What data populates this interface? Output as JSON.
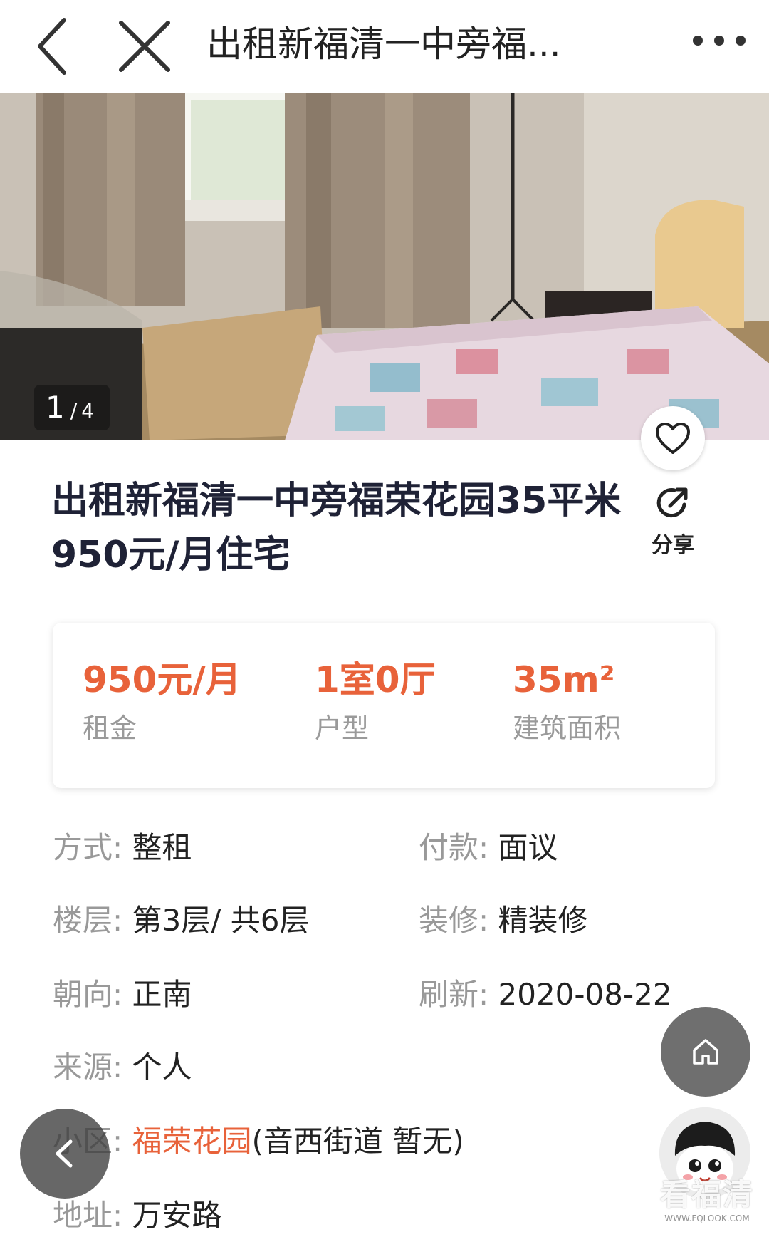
{
  "nav": {
    "title": "出租新福清一中旁福..."
  },
  "gallery": {
    "current": "1",
    "separator": "/",
    "total": "4"
  },
  "listing": {
    "title": "出租新福清一中旁福荣花园35平米950元/月住宅",
    "share_label": "分享"
  },
  "summary": [
    {
      "value": "950元/月",
      "label": "租金"
    },
    {
      "value": "1室0厅",
      "label": "户型"
    },
    {
      "value": "35m²",
      "label": "建筑面积"
    }
  ],
  "attributes": {
    "mode": {
      "key": "方式:",
      "value": "整租"
    },
    "payment": {
      "key": "付款:",
      "value": "面议"
    },
    "floor": {
      "key": "楼层:",
      "value": "第3层/ 共6层"
    },
    "decoration": {
      "key": "装修:",
      "value": "精装修"
    },
    "orientation": {
      "key": "朝向:",
      "value": "正南"
    },
    "refresh": {
      "key": "刷新:",
      "value": "2020-08-22"
    },
    "source": {
      "key": "来源:",
      "value": "个人"
    },
    "community": {
      "key": "小区:",
      "link": "福荣花园",
      "value": "(音西街道 暂无)"
    },
    "address": {
      "key": "地址:",
      "value": "万安路"
    }
  },
  "watermark": {
    "main": "看福清",
    "sub": "WWW.FQLOOK.COM"
  },
  "colors": {
    "accent": "#e8623a",
    "title": "#1f2236",
    "muted": "#999999"
  },
  "icons": [
    "back-arrow-icon",
    "close-icon",
    "more-dots-icon",
    "heart-icon",
    "share-icon",
    "home-icon",
    "mascot-avatar-icon"
  ]
}
